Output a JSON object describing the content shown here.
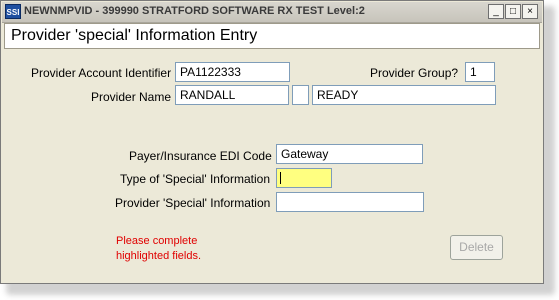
{
  "window": {
    "icon_text": "SSI",
    "title": "NEWNMPVID - 399990 STRATFORD SOFTWARE RX TEST Level:2",
    "minimize_glyph": "_",
    "maximize_glyph": "□",
    "close_glyph": "×"
  },
  "panel": {
    "title": "Provider 'special' Information Entry"
  },
  "provider": {
    "account_label": "Provider Account Identifier",
    "account_value": "PA1122333",
    "group_label": "Provider Group?",
    "group_value": "1",
    "name_label": "Provider Name",
    "last_name": "RANDALL",
    "middle_initial": "",
    "first_name": "READY"
  },
  "special": {
    "edi_label": "Payer/Insurance EDI Code",
    "edi_value": "Gateway",
    "type_label": "Type of 'Special' Information",
    "type_value": "",
    "info_label": "Provider 'Special' Information",
    "info_value": ""
  },
  "messages": {
    "error_line1": "Please complete",
    "error_line2": "highlighted fields."
  },
  "buttons": {
    "delete": "Delete"
  },
  "colors": {
    "highlight": "#ffff80",
    "error_text": "#e00000"
  }
}
